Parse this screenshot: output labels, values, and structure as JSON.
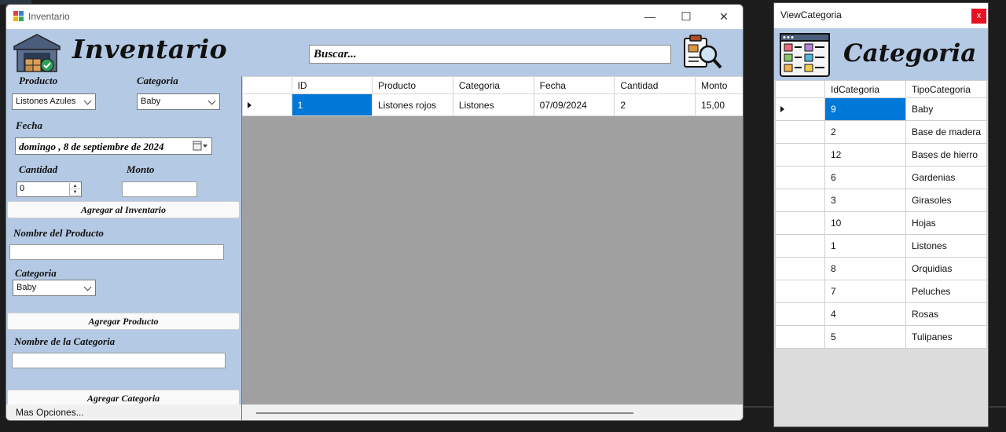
{
  "main_window": {
    "title": "Inventario",
    "brand": "Inventario",
    "search_value": "Buscar...",
    "caption_buttons": {
      "minimize": "—",
      "maximize": "☐",
      "close": "✕"
    },
    "form": {
      "producto_label": "Producto",
      "producto_value": "Listones Azules",
      "categoria_label": "Categoria",
      "categoria_value": "Baby",
      "fecha_label": "Fecha",
      "fecha_value": "domingo ,   8 de septiembre de 2024",
      "cantidad_label": "Cantidad",
      "cantidad_value": "0",
      "monto_label": "Monto",
      "agregar_inventario": "Agregar al Inventario",
      "nombre_producto_label": "Nombre del Producto",
      "categoria2_label": "Categoria",
      "categoria2_value": "Baby",
      "agregar_producto": "Agregar Producto",
      "nombre_categoria_label": "Nombre de la Categoria",
      "agregar_categoria": "Agregar Categoria"
    },
    "status_text": "Mas Opciones...",
    "grid": {
      "columns": [
        "ID",
        "Producto",
        "Categoria",
        "Fecha",
        "Cantidad",
        "Monto"
      ],
      "rows": [
        [
          "1",
          "Listones rojos",
          "Listones",
          "07/09/2024",
          "2",
          "15,00"
        ]
      ]
    }
  },
  "categoria_window": {
    "title": "ViewCategoria",
    "close": "x",
    "brand": "Categoria",
    "columns": [
      "IdCategoria",
      "TipoCategoria"
    ],
    "rows": [
      [
        "9",
        "Baby"
      ],
      [
        "2",
        "Base de madera"
      ],
      [
        "12",
        "Bases de hierro"
      ],
      [
        "6",
        "Gardenias"
      ],
      [
        "3",
        "Girasoles"
      ],
      [
        "10",
        "Hojas"
      ],
      [
        "1",
        "Listones"
      ],
      [
        "8",
        "Orquidias"
      ],
      [
        "7",
        "Peluches"
      ],
      [
        "4",
        "Rosas"
      ],
      [
        "5",
        "Tulipanes"
      ]
    ]
  },
  "colors": {
    "panel_blue": "#b4c9e4",
    "selection": "#0078d7",
    "close_red": "#e81123"
  }
}
